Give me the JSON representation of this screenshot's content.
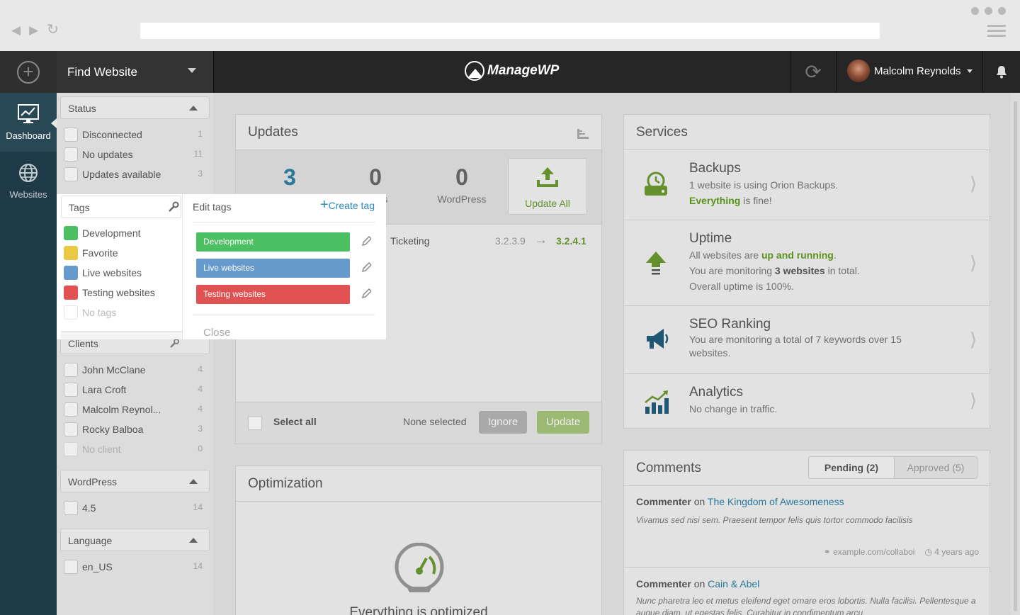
{
  "topbar": {
    "find_website": "Find Website",
    "logo": "ManageWP",
    "user_name": "Malcolm Reynolds"
  },
  "rail": {
    "items": [
      {
        "label": "Dashboard"
      },
      {
        "label": "Websites"
      }
    ]
  },
  "filters": {
    "status": {
      "title": "Status",
      "items": [
        {
          "label": "Disconnected",
          "count": "1"
        },
        {
          "label": "No updates",
          "count": "11"
        },
        {
          "label": "Updates available",
          "count": "3"
        }
      ]
    },
    "tags": {
      "title": "Tags",
      "items": [
        {
          "label": "Development",
          "color": "#4cbf62"
        },
        {
          "label": "Favorite",
          "color": "#e9c945"
        },
        {
          "label": "Live websites",
          "color": "#6699cc"
        },
        {
          "label": "Testing websites",
          "color": "#e05252"
        },
        {
          "label": "No tags"
        }
      ]
    },
    "clients": {
      "title": "Clients",
      "items": [
        {
          "label": "John McClane",
          "count": "4"
        },
        {
          "label": "Lara Croft",
          "count": "4"
        },
        {
          "label": "Malcolm Reynol...",
          "count": "4"
        },
        {
          "label": "Rocky Balboa",
          "count": "3"
        },
        {
          "label": "No client",
          "count": "0"
        }
      ]
    },
    "wordpress": {
      "title": "WordPress",
      "items": [
        {
          "label": "4.5",
          "count": "14"
        }
      ]
    },
    "language": {
      "title": "Language",
      "items": [
        {
          "label": "en_US",
          "count": "14"
        }
      ]
    }
  },
  "edit_tags": {
    "title": "Edit tags",
    "create": "Create tag",
    "tags": [
      {
        "label": "Development",
        "color": "#4cbf62"
      },
      {
        "label": "Live websites",
        "color": "#6699cc"
      },
      {
        "label": "Testing websites",
        "color": "#e05252"
      }
    ],
    "close": "Close"
  },
  "updates": {
    "title": "Updates",
    "stats": [
      {
        "num": "3",
        "label": ""
      },
      {
        "num": "0",
        "label": "es"
      },
      {
        "num": "0",
        "label": "WordPress"
      }
    ],
    "update_all": "Update All",
    "row": {
      "name": "Ticketing",
      "from": "3.2.3.9",
      "to": "3.2.4.1"
    },
    "select_all": "Select all",
    "none_selected": "None selected",
    "ignore": "Ignore",
    "update": "Update"
  },
  "optimization": {
    "title": "Optimization",
    "status": "Everything is optimized"
  },
  "services": {
    "title": "Services",
    "backups": {
      "title": "Backups",
      "line1": "1 website is using Orion Backups.",
      "everything": "Everything",
      "fine": " is fine!"
    },
    "uptime": {
      "title": "Uptime",
      "pre": "All websites are ",
      "running": "up and running",
      "post": ".",
      "mon_pre": "You are monitoring ",
      "mon_b": "3 websites",
      "mon_post": " in total.",
      "overall": "Overall uptime is 100%."
    },
    "seo": {
      "title": "SEO Ranking",
      "desc": "You are monitoring a total of 7 keywords over 15 websites."
    },
    "analytics": {
      "title": "Analytics",
      "desc": "No change in traffic."
    }
  },
  "comments": {
    "title": "Comments",
    "pending": "Pending (2)",
    "approved": "Approved (5)",
    "items": [
      {
        "author": "Commenter",
        "on": "on",
        "post": "The Kingdom of Awesomeness",
        "text": "Vivamus sed nisi sem. Praesent tempor felis quis tortor commodo facilisis",
        "site": "example.com/collaboi",
        "time": "4 years ago"
      },
      {
        "author": "Commenter",
        "on": "on",
        "post": "Cain & Abel",
        "text": "Nunc pharetra leo et metus eleifend eget ornare eros lobortis. Nulla facilisi. Pellentesque a augue diam, ut egestas felis. Curabitur in condimentum arcu."
      }
    ]
  }
}
